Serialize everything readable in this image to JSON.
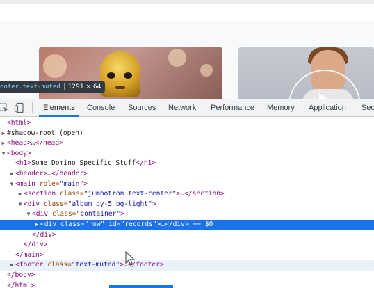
{
  "tooltip": {
    "selector": "ooter.text-muted",
    "dimensions": "1291 × 64"
  },
  "devtools": {
    "tabs": [
      "Elements",
      "Console",
      "Sources",
      "Network",
      "Performance",
      "Memory",
      "Application",
      "Sec"
    ],
    "active_tab": "Elements"
  },
  "dom": [
    {
      "indent": 0,
      "toggle": "",
      "text": "<html>",
      "state": ""
    },
    {
      "indent": 0,
      "toggle": "▶",
      "text": "#shadow-root (open)",
      "state": ""
    },
    {
      "indent": 0,
      "toggle": "▶",
      "text": "<head>…</head>",
      "state": ""
    },
    {
      "indent": 0,
      "toggle": "▼",
      "text": "<body>",
      "state": ""
    },
    {
      "indent": 1,
      "toggle": "",
      "text": "<h1>Some Domino Specific Stuff</h1>",
      "state": ""
    },
    {
      "indent": 1,
      "toggle": "▶",
      "text": "<header>…</header>",
      "state": ""
    },
    {
      "indent": 1,
      "toggle": "▼",
      "text": "<main role=\"main\">",
      "state": ""
    },
    {
      "indent": 2,
      "toggle": "▶",
      "text": "<section class=\"jumbotron text-center\">…</section>",
      "state": ""
    },
    {
      "indent": 2,
      "toggle": "▼",
      "text": "<div class=\"album py-5 bg-light\">",
      "state": ""
    },
    {
      "indent": 3,
      "toggle": "▼",
      "text": "<div class=\"container\">",
      "state": ""
    },
    {
      "indent": 4,
      "toggle": "▶",
      "text": "<div class=\"row\" id=\"records\">…</div> == $0",
      "state": "selected"
    },
    {
      "indent": 3,
      "toggle": "",
      "text": "</div>",
      "state": ""
    },
    {
      "indent": 2,
      "toggle": "",
      "text": "</div>",
      "state": ""
    },
    {
      "indent": 1,
      "toggle": "",
      "text": "</main>",
      "state": ""
    },
    {
      "indent": 1,
      "toggle": "▶",
      "text": "<footer class=\"text-muted\">…</footer>",
      "state": "hovered"
    },
    {
      "indent": 0,
      "toggle": "",
      "text": "</body>",
      "state": ""
    },
    {
      "indent": 0,
      "toggle": "",
      "text": "</html>",
      "state": ""
    }
  ],
  "colors": {
    "accent": "#1a73e8",
    "tag": "#881280",
    "attr_name": "#994500",
    "attr_value": "#1a1aa6",
    "text": "#202124"
  }
}
